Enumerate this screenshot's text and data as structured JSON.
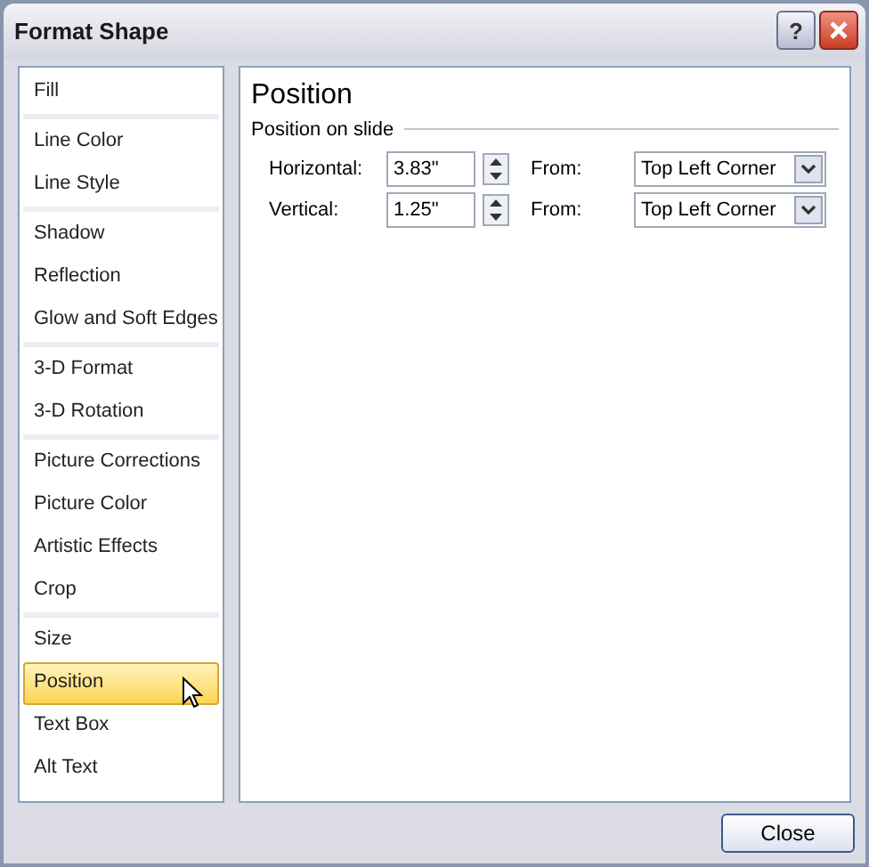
{
  "window": {
    "title": "Format Shape",
    "help_button": "?"
  },
  "sidebar": {
    "groups": [
      {
        "items": [
          {
            "label": "Fill",
            "selected": false
          }
        ]
      },
      {
        "items": [
          {
            "label": "Line Color",
            "selected": false
          },
          {
            "label": "Line Style",
            "selected": false
          }
        ]
      },
      {
        "items": [
          {
            "label": "Shadow",
            "selected": false
          },
          {
            "label": "Reflection",
            "selected": false
          },
          {
            "label": "Glow and Soft Edges",
            "selected": false
          }
        ]
      },
      {
        "items": [
          {
            "label": "3-D Format",
            "selected": false
          },
          {
            "label": "3-D Rotation",
            "selected": false
          }
        ]
      },
      {
        "items": [
          {
            "label": "Picture Corrections",
            "selected": false
          },
          {
            "label": "Picture Color",
            "selected": false
          },
          {
            "label": "Artistic Effects",
            "selected": false
          },
          {
            "label": "Crop",
            "selected": false
          }
        ]
      },
      {
        "items": [
          {
            "label": "Size",
            "selected": false
          },
          {
            "label": "Position",
            "selected": true
          },
          {
            "label": "Text Box",
            "selected": false
          },
          {
            "label": "Alt Text",
            "selected": false
          }
        ]
      }
    ]
  },
  "panel": {
    "title": "Position",
    "section": "Position on slide",
    "rows": [
      {
        "label": "Horizontal:",
        "value": "3.83\"",
        "from_label": "From:",
        "from_value": "Top Left Corner"
      },
      {
        "label": "Vertical:",
        "value": "1.25\"",
        "from_label": "From:",
        "from_value": "Top Left Corner"
      }
    ]
  },
  "buttons": [
    "Close"
  ]
}
